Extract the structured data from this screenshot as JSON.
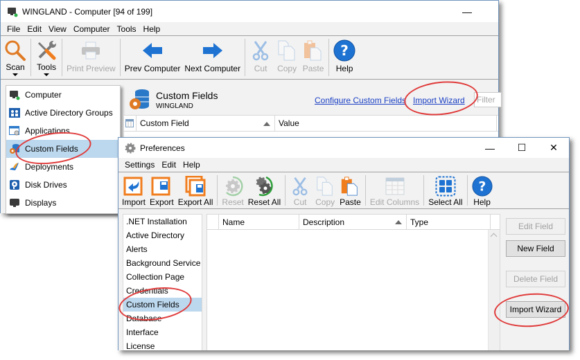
{
  "main_window": {
    "title": "WINGLAND - Computer [94 of 199]",
    "controls": {
      "minimize": "—"
    },
    "menu": [
      "File",
      "Edit",
      "View",
      "Computer",
      "Tools",
      "Help"
    ],
    "toolbar": {
      "scan": "Scan",
      "tools": "Tools",
      "print_preview": "Print Preview",
      "prev_computer": "Prev Computer",
      "next_computer": "Next Computer",
      "cut": "Cut",
      "copy": "Copy",
      "paste": "Paste",
      "help": "Help"
    },
    "nav": [
      {
        "label": "Computer",
        "icon": "computer-icon"
      },
      {
        "label": "Active Directory Groups",
        "icon": "ad-groups-icon"
      },
      {
        "label": "Applications",
        "icon": "applications-icon"
      },
      {
        "label": "Custom Fields",
        "icon": "custom-fields-icon",
        "selected": true
      },
      {
        "label": "Deployments",
        "icon": "deployments-icon"
      },
      {
        "label": "Disk Drives",
        "icon": "disk-drives-icon"
      },
      {
        "label": "Displays",
        "icon": "displays-icon"
      }
    ],
    "content": {
      "title": "Custom Fields",
      "subtitle": "WINGLAND",
      "configure_link": "Configure Custom Fields",
      "import_link": "Import Wizard",
      "filter_placeholder": "Filter",
      "columns": [
        "Custom Field",
        "Value"
      ]
    }
  },
  "preferences_window": {
    "title": "Preferences",
    "controls": {
      "minimize": "—",
      "maximize": "☐",
      "close": "✕"
    },
    "menu": [
      "Settings",
      "Edit",
      "Help"
    ],
    "toolbar": {
      "import": "Import",
      "export": "Export",
      "export_all": "Export All",
      "reset": "Reset",
      "reset_all": "Reset All",
      "cut": "Cut",
      "copy": "Copy",
      "paste": "Paste",
      "edit_columns": "Edit Columns",
      "select_all": "Select All",
      "help": "Help"
    },
    "categories": [
      ".NET Installation",
      "Active Directory",
      "Alerts",
      "Background Service",
      "Collection Page",
      "Credentials",
      "Custom Fields",
      "Database",
      "Interface",
      "License"
    ],
    "selected_category": "Custom Fields",
    "columns": [
      "Name",
      "Description",
      "Type"
    ],
    "buttons": {
      "edit_field": "Edit Field",
      "new_field": "New Field",
      "delete_field": "Delete Field",
      "import_wizard": "Import Wizard"
    }
  },
  "colors": {
    "accent_blue": "#1e73d2",
    "orange": "#f07d1e",
    "selection": "#bcd8ee",
    "link": "#1a3fc4",
    "annotation_red": "#e03a3a"
  }
}
